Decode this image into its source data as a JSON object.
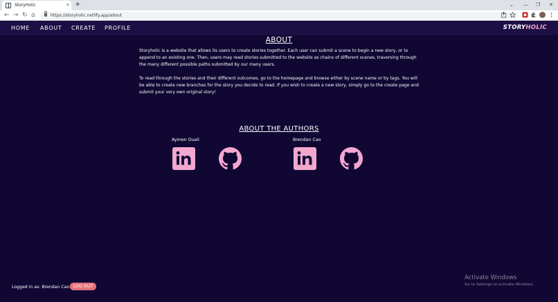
{
  "browser": {
    "tab_title": "StoryHolic",
    "tab_close": "×",
    "new_tab": "+",
    "url": "https://storyholic.netlify.app/about",
    "nav": {
      "back": "←",
      "forward": "→",
      "reload": "↻",
      "home": "⌂"
    },
    "window_controls": {
      "chevron": "⌄",
      "minimize": "—",
      "restore": "❐",
      "close": "✕"
    }
  },
  "app": {
    "nav_items": [
      "HOME",
      "ABOUT",
      "CREATE",
      "PROFILE"
    ],
    "brand_part1": "STORY",
    "brand_part2": "HOLIC",
    "brand_colors": {
      "white": "#ffffff",
      "pink": "#f2a7cf"
    }
  },
  "about": {
    "heading": "ABOUT",
    "paragraph1": "Storyholic is a website that allows its users to create stories together. Each user can submit a scene to begin a new story, or to append to an existing one. Then, users may read stories submitted to the website as chains of different scenes, traversing through the many different possible paths submitted by our many users.",
    "paragraph2": "To read through the stories and their different outcomes, go to the homepage and browse either by scene name or by tags. You will be able to create new branches for the story you decide to read. If you wish to create a new story, simply go to the create page and submit your very own original story!"
  },
  "authors": {
    "heading": "ABOUT THE AUTHORS",
    "list": [
      {
        "name": "Aymen Ouali"
      },
      {
        "name": "Brendan Cao"
      }
    ]
  },
  "footer": {
    "logged_in_label": "Logged in as: Brendan Cao",
    "logout_label": "LOG OUT"
  },
  "watermark": {
    "line1": "Activate Windows",
    "line2": "Go to Settings to activate Windows."
  },
  "colors": {
    "background": "#100733",
    "nav_background": "#1c0f45",
    "accent_pink": "#f2a7cf",
    "logout_button": "#e5737b"
  },
  "icons": [
    "linkedin-icon",
    "github-icon",
    "lock-icon",
    "share-icon",
    "star-icon",
    "extension-icon",
    "profile-avatar"
  ]
}
